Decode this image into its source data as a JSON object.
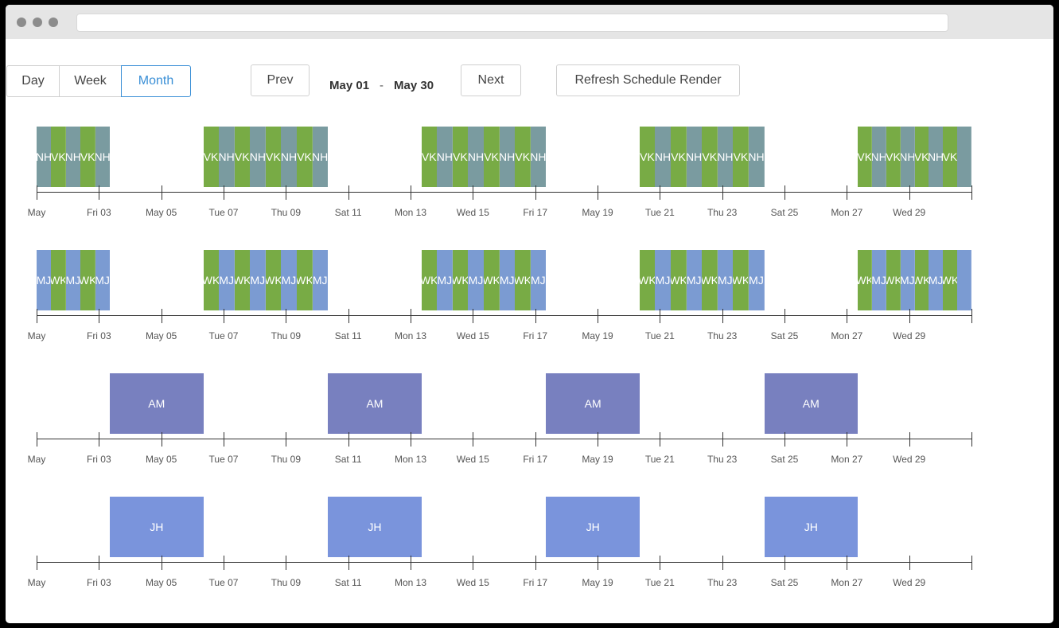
{
  "toolbar": {
    "views": [
      "Day",
      "Week",
      "Month"
    ],
    "active_view": "Month",
    "prev_label": "Prev",
    "next_label": "Next",
    "range_start": "May 01",
    "range_sep": "-",
    "range_end": "May 30",
    "refresh_label": "Refresh Schedule Render"
  },
  "axis_ticks": [
    "May",
    "Fri 03",
    "May 05",
    "Tue 07",
    "Thu 09",
    "Sat 11",
    "Mon 13",
    "Wed 15",
    "Fri 17",
    "May 19",
    "Tue 21",
    "Thu 23",
    "Sat 25",
    "Mon 27",
    "Wed 29",
    ""
  ],
  "colors": {
    "green": "#78ab45",
    "teal": "#7a9ba0",
    "blue": "#7b9bd2",
    "purple": "#7880bf",
    "lightblue": "#7a94dc"
  },
  "rows": [
    {
      "type": "stripes",
      "blocks": [
        {
          "start": 1,
          "end": 3.35,
          "stripes": [
            {
              "label": "NH",
              "color": "teal"
            },
            {
              "label": "VK",
              "color": "green"
            },
            {
              "label": "NH",
              "color": "teal"
            },
            {
              "label": "VK",
              "color": "green"
            },
            {
              "label": "NH",
              "color": "teal"
            }
          ]
        },
        {
          "start": 6.35,
          "end": 10.35,
          "stripes": [
            {
              "label": "VK",
              "color": "green"
            },
            {
              "label": "NH",
              "color": "teal"
            },
            {
              "label": "VK",
              "color": "green"
            },
            {
              "label": "NH",
              "color": "teal"
            },
            {
              "label": "VK",
              "color": "green"
            },
            {
              "label": "NH",
              "color": "teal"
            },
            {
              "label": "VK",
              "color": "green"
            },
            {
              "label": "NH",
              "color": "teal"
            }
          ]
        },
        {
          "start": 13.35,
          "end": 17.35,
          "stripes": [
            {
              "label": "VK",
              "color": "green"
            },
            {
              "label": "NH",
              "color": "teal"
            },
            {
              "label": "VK",
              "color": "green"
            },
            {
              "label": "NH",
              "color": "teal"
            },
            {
              "label": "VK",
              "color": "green"
            },
            {
              "label": "NH",
              "color": "teal"
            },
            {
              "label": "VK",
              "color": "green"
            },
            {
              "label": "NH",
              "color": "teal"
            }
          ]
        },
        {
          "start": 20.35,
          "end": 24.35,
          "stripes": [
            {
              "label": "VK",
              "color": "green"
            },
            {
              "label": "NH",
              "color": "teal"
            },
            {
              "label": "VK",
              "color": "green"
            },
            {
              "label": "NH",
              "color": "teal"
            },
            {
              "label": "VK",
              "color": "green"
            },
            {
              "label": "NH",
              "color": "teal"
            },
            {
              "label": "VK",
              "color": "green"
            },
            {
              "label": "NH",
              "color": "teal"
            }
          ]
        },
        {
          "start": 27.35,
          "end": 31,
          "stripes": [
            {
              "label": "VK",
              "color": "green"
            },
            {
              "label": "NH",
              "color": "teal"
            },
            {
              "label": "VK",
              "color": "green"
            },
            {
              "label": "NH",
              "color": "teal"
            },
            {
              "label": "VK",
              "color": "green"
            },
            {
              "label": "NH",
              "color": "teal"
            },
            {
              "label": "VK",
              "color": "green"
            },
            {
              "label": "",
              "color": "teal"
            }
          ]
        }
      ]
    },
    {
      "type": "stripes",
      "blocks": [
        {
          "start": 1,
          "end": 3.35,
          "stripes": [
            {
              "label": "MJ",
              "color": "blue"
            },
            {
              "label": "WK",
              "color": "green"
            },
            {
              "label": "MJ",
              "color": "blue"
            },
            {
              "label": "WK",
              "color": "green"
            },
            {
              "label": "MJ",
              "color": "blue"
            }
          ]
        },
        {
          "start": 6.35,
          "end": 10.35,
          "stripes": [
            {
              "label": "WK",
              "color": "green"
            },
            {
              "label": "MJ",
              "color": "blue"
            },
            {
              "label": "WK",
              "color": "green"
            },
            {
              "label": "MJ",
              "color": "blue"
            },
            {
              "label": "WK",
              "color": "green"
            },
            {
              "label": "MJ",
              "color": "blue"
            },
            {
              "label": "WK",
              "color": "green"
            },
            {
              "label": "MJ",
              "color": "blue"
            }
          ]
        },
        {
          "start": 13.35,
          "end": 17.35,
          "stripes": [
            {
              "label": "WK",
              "color": "green"
            },
            {
              "label": "MJ",
              "color": "blue"
            },
            {
              "label": "WK",
              "color": "green"
            },
            {
              "label": "MJ",
              "color": "blue"
            },
            {
              "label": "WK",
              "color": "green"
            },
            {
              "label": "MJ",
              "color": "blue"
            },
            {
              "label": "WK",
              "color": "green"
            },
            {
              "label": "MJ",
              "color": "blue"
            }
          ]
        },
        {
          "start": 20.35,
          "end": 24.35,
          "stripes": [
            {
              "label": "WK",
              "color": "green"
            },
            {
              "label": "MJ",
              "color": "blue"
            },
            {
              "label": "WK",
              "color": "green"
            },
            {
              "label": "MJ",
              "color": "blue"
            },
            {
              "label": "WK",
              "color": "green"
            },
            {
              "label": "MJ",
              "color": "blue"
            },
            {
              "label": "WK",
              "color": "green"
            },
            {
              "label": "MJ",
              "color": "blue"
            }
          ]
        },
        {
          "start": 27.35,
          "end": 31,
          "stripes": [
            {
              "label": "WK",
              "color": "green"
            },
            {
              "label": "MJ",
              "color": "blue"
            },
            {
              "label": "WK",
              "color": "green"
            },
            {
              "label": "MJ",
              "color": "blue"
            },
            {
              "label": "WK",
              "color": "green"
            },
            {
              "label": "MJ",
              "color": "blue"
            },
            {
              "label": "WK",
              "color": "green"
            },
            {
              "label": "",
              "color": "blue"
            }
          ]
        }
      ]
    },
    {
      "type": "solid",
      "color": "purple",
      "blocks": [
        {
          "start": 3.35,
          "end": 6.35,
          "label": "AM"
        },
        {
          "start": 10.35,
          "end": 13.35,
          "label": "AM"
        },
        {
          "start": 17.35,
          "end": 20.35,
          "label": "AM"
        },
        {
          "start": 24.35,
          "end": 27.35,
          "label": "AM"
        }
      ]
    },
    {
      "type": "solid",
      "color": "lightblue",
      "blocks": [
        {
          "start": 3.35,
          "end": 6.35,
          "label": "JH"
        },
        {
          "start": 10.35,
          "end": 13.35,
          "label": "JH"
        },
        {
          "start": 17.35,
          "end": 20.35,
          "label": "JH"
        },
        {
          "start": 24.35,
          "end": 27.35,
          "label": "JH"
        }
      ]
    }
  ]
}
